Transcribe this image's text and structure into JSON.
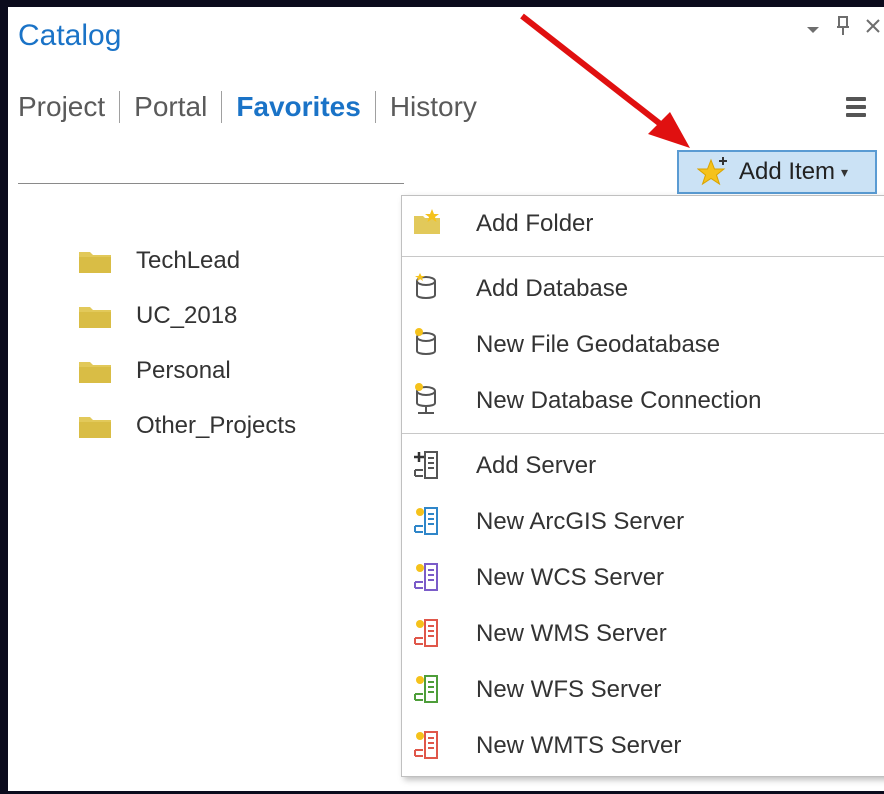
{
  "panel": {
    "title": "Catalog",
    "window_controls": [
      "▾",
      "ᵖ",
      "✕"
    ]
  },
  "tabs": [
    {
      "label": "Project",
      "active": false
    },
    {
      "label": "Portal",
      "active": false
    },
    {
      "label": "Favorites",
      "active": true
    },
    {
      "label": "History",
      "active": false
    }
  ],
  "add_item_button": {
    "label": "Add Item",
    "caret": "▾"
  },
  "folders": [
    {
      "label": "TechLead"
    },
    {
      "label": "UC_2018"
    },
    {
      "label": "Personal"
    },
    {
      "label": "Other_Projects"
    }
  ],
  "menu": {
    "groups": [
      [
        {
          "label": "Add Folder",
          "icon": "add-folder-icon"
        }
      ],
      [
        {
          "label": "Add Database",
          "icon": "add-database-icon"
        },
        {
          "label": "New File Geodatabase",
          "icon": "new-geodatabase-icon"
        },
        {
          "label": "New Database Connection",
          "icon": "database-connection-icon"
        }
      ],
      [
        {
          "label": "Add Server",
          "icon": "add-server-icon"
        },
        {
          "label": "New ArcGIS Server",
          "icon": "arcgis-server-icon"
        },
        {
          "label": "New WCS Server",
          "icon": "wcs-server-icon"
        },
        {
          "label": "New WMS Server",
          "icon": "wms-server-icon"
        },
        {
          "label": "New WFS Server",
          "icon": "wfs-server-icon"
        },
        {
          "label": "New WMTS Server",
          "icon": "wmts-server-icon"
        }
      ]
    ]
  },
  "colors": {
    "accent": "#1a73c7",
    "button_bg": "#cbe2f5",
    "button_border": "#5a9bd3",
    "folder": "#e2c95a",
    "annotation_arrow": "#e01010",
    "wcs": "#7b5cc9",
    "wms": "#e0574a",
    "wfs": "#4e9e3a",
    "wmts": "#e0574a",
    "arcgis": "#2f86c9"
  }
}
